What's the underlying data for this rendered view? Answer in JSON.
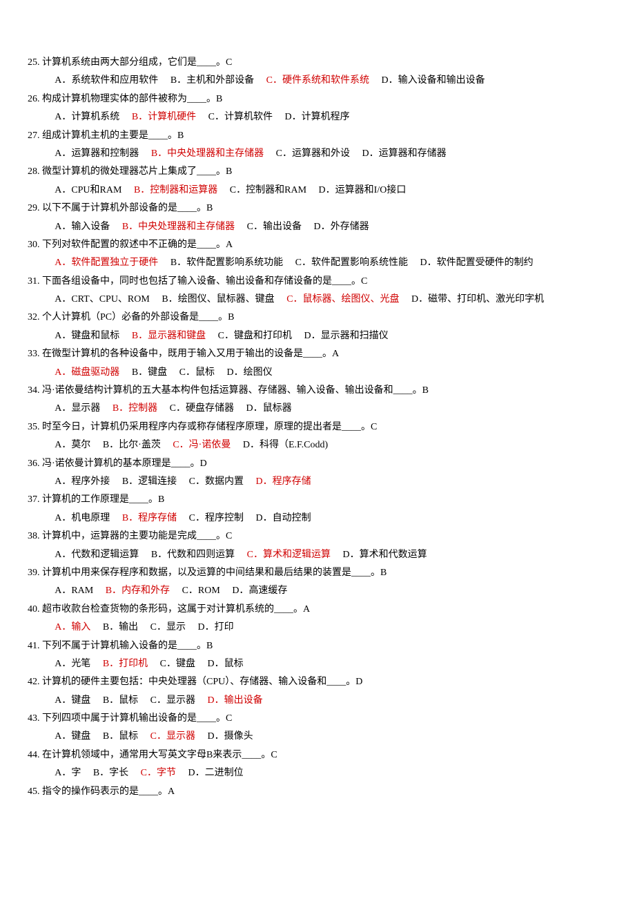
{
  "questions": [
    {
      "num": "25.",
      "text": "计算机系统由两大部分组成，它们是____。",
      "ans": "C",
      "opts": [
        {
          "l": "A．",
          "t": "系统软件和应用软件",
          "c": false
        },
        {
          "l": "B．",
          "t": "主机和外部设备",
          "c": false
        },
        {
          "l": "C．",
          "t": "硬件系统和软件系统",
          "c": true
        },
        {
          "l": "D．",
          "t": "输入设备和输出设备",
          "c": false
        }
      ]
    },
    {
      "num": "26.",
      "text": "构成计算机物理实体的部件被称为____。",
      "ans": "B",
      "opts": [
        {
          "l": "A．",
          "t": "计算机系统",
          "c": false
        },
        {
          "l": "B．",
          "t": "计算机硬件",
          "c": true
        },
        {
          "l": "C．",
          "t": "计算机软件",
          "c": false
        },
        {
          "l": "D．",
          "t": "计算机程序",
          "c": false
        }
      ]
    },
    {
      "num": "27.",
      "text": "组成计算机主机的主要是____。",
      "ans": "B",
      "opts": [
        {
          "l": "A．",
          "t": "运算器和控制器",
          "c": false
        },
        {
          "l": "B．",
          "t": "中央处理器和主存储器",
          "c": true
        },
        {
          "l": "C．",
          "t": "运算器和外设",
          "c": false
        },
        {
          "l": "D．",
          "t": "运算器和存储器",
          "c": false
        }
      ]
    },
    {
      "num": "28.",
      "text": "微型计算机的微处理器芯片上集成了____。",
      "ans": "B",
      "opts": [
        {
          "l": "A．",
          "t": "CPU和RAM",
          "c": false
        },
        {
          "l": "B．",
          "t": "控制器和运算器",
          "c": true
        },
        {
          "l": "C．",
          "t": "控制器和RAM",
          "c": false
        },
        {
          "l": "D．",
          "t": "运算器和I/O接口",
          "c": false
        }
      ]
    },
    {
      "num": "29.",
      "text": "以下不属于计算机外部设备的是____。",
      "ans": "B",
      "opts": [
        {
          "l": "A．",
          "t": "输入设备",
          "c": false
        },
        {
          "l": "B．",
          "t": "中央处理器和主存储器",
          "c": true
        },
        {
          "l": "C．",
          "t": "输出设备",
          "c": false
        },
        {
          "l": "D．",
          "t": "外存储器",
          "c": false
        }
      ]
    },
    {
      "num": "30.",
      "text": "下列对软件配置的叙述中不正确的是____。",
      "ans": "A",
      "opts": [
        {
          "l": "A．",
          "t": "软件配置独立于硬件",
          "c": true
        },
        {
          "l": "B．",
          "t": "软件配置影响系统功能",
          "c": false
        },
        {
          "l": "C．",
          "t": "软件配置影响系统性能",
          "c": false
        },
        {
          "l": "D．",
          "t": "软件配置受硬件的制约",
          "c": false
        }
      ]
    },
    {
      "num": "31.",
      "text": "下面各组设备中，同时也包括了输入设备、输出设备和存储设备的是____。",
      "ans": "C",
      "opts": [
        {
          "l": "A．",
          "t": "CRT、CPU、ROM",
          "c": false
        },
        {
          "l": "B．",
          "t": "绘图仪、鼠标器、键盘",
          "c": false
        },
        {
          "l": "C．",
          "t": "鼠标器、绘图仪、光盘",
          "c": true
        },
        {
          "l": "D．",
          "t": "磁带、打印机、激光印字机",
          "c": false
        }
      ]
    },
    {
      "num": "32.",
      "text": "个人计算机（PC）必备的外部设备是____。",
      "ans": "B",
      "opts": [
        {
          "l": "A．",
          "t": "键盘和鼠标",
          "c": false
        },
        {
          "l": "B．",
          "t": "显示器和键盘",
          "c": true
        },
        {
          "l": "C．",
          "t": "键盘和打印机",
          "c": false
        },
        {
          "l": "D．",
          "t": "显示器和扫描仪",
          "c": false
        }
      ]
    },
    {
      "num": "33.",
      "text": "在微型计算机的各种设备中，既用于输入又用于输出的设备是____。",
      "ans": "A",
      "opts": [
        {
          "l": "A．",
          "t": "磁盘驱动器",
          "c": true
        },
        {
          "l": "B．",
          "t": "键盘",
          "c": false
        },
        {
          "l": "C．",
          "t": "鼠标",
          "c": false
        },
        {
          "l": "D．",
          "t": "绘图仪",
          "c": false
        }
      ]
    },
    {
      "num": "34.",
      "text": "冯·诺依曼结构计算机的五大基本构件包括运算器、存储器、输入设备、输出设备和____。",
      "ans": "B",
      "opts": [
        {
          "l": "A．",
          "t": "显示器",
          "c": false
        },
        {
          "l": "B．",
          "t": "控制器",
          "c": true
        },
        {
          "l": "C．",
          "t": "硬盘存储器",
          "c": false
        },
        {
          "l": "D．",
          "t": "鼠标器",
          "c": false
        }
      ]
    },
    {
      "num": "35.",
      "text": "时至今日，计算机仍采用程序内存或称存储程序原理，原理的提出者是____。",
      "ans": "C",
      "opts": [
        {
          "l": "A．",
          "t": "莫尔",
          "c": false
        },
        {
          "l": "B．",
          "t": "比尔·盖茨",
          "c": false
        },
        {
          "l": "C．",
          "t": "冯·诺依曼",
          "c": true
        },
        {
          "l": "D．",
          "t": "科得（E.F.Codd)",
          "c": false
        }
      ]
    },
    {
      "num": "36.",
      "text": "冯·诺依曼计算机的基本原理是____。",
      "ans": "D",
      "opts": [
        {
          "l": "A．",
          "t": "程序外接",
          "c": false
        },
        {
          "l": "B．",
          "t": "逻辑连接",
          "c": false
        },
        {
          "l": "C．",
          "t": "数据内置",
          "c": false
        },
        {
          "l": "D．",
          "t": "程序存储",
          "c": true
        }
      ]
    },
    {
      "num": "37.",
      "text": "计算机的工作原理是____。",
      "ans": "B",
      "opts": [
        {
          "l": "A．",
          "t": "机电原理",
          "c": false
        },
        {
          "l": "B．",
          "t": "程序存储",
          "c": true
        },
        {
          "l": "C．",
          "t": "程序控制",
          "c": false
        },
        {
          "l": "D．",
          "t": "自动控制",
          "c": false
        }
      ]
    },
    {
      "num": "38.",
      "text": "计算机中，运算器的主要功能是完成____。",
      "ans": "C",
      "opts": [
        {
          "l": "A．",
          "t": "代数和逻辑运算",
          "c": false
        },
        {
          "l": "B．",
          "t": "代数和四则运算",
          "c": false
        },
        {
          "l": "C．",
          "t": "算术和逻辑运算",
          "c": true
        },
        {
          "l": "D．",
          "t": "算术和代数运算",
          "c": false
        }
      ]
    },
    {
      "num": "39.",
      "text": "计算机中用来保存程序和数据，以及运算的中间结果和最后结果的装置是____。",
      "ans": "B",
      "opts": [
        {
          "l": "A．",
          "t": "RAM",
          "c": false
        },
        {
          "l": "B．",
          "t": "内存和外存",
          "c": true
        },
        {
          "l": "C．",
          "t": "ROM",
          "c": false
        },
        {
          "l": "D．",
          "t": "高速缓存",
          "c": false
        }
      ]
    },
    {
      "num": "40.",
      "text": "超市收款台检查货物的条形码，这属于对计算机系统的____。",
      "ans": "A",
      "opts": [
        {
          "l": "A．",
          "t": "输入",
          "c": true
        },
        {
          "l": "B．",
          "t": "输出",
          "c": false
        },
        {
          "l": "C．",
          "t": "显示",
          "c": false
        },
        {
          "l": "D．",
          "t": "打印",
          "c": false
        }
      ]
    },
    {
      "num": "41.",
      "text": "下列不属于计算机输入设备的是____。",
      "ans": "B",
      "opts": [
        {
          "l": "A．",
          "t": "光笔",
          "c": false
        },
        {
          "l": "B．",
          "t": "打印机",
          "c": true
        },
        {
          "l": "C．",
          "t": "键盘",
          "c": false
        },
        {
          "l": "D．",
          "t": "鼠标",
          "c": false
        }
      ]
    },
    {
      "num": "42.",
      "text": "计算机的硬件主要包括：中央处理器（CPU）、存储器、输入设备和____。",
      "ans": "D",
      "opts": [
        {
          "l": "A．",
          "t": "键盘",
          "c": false
        },
        {
          "l": "B．",
          "t": "鼠标",
          "c": false
        },
        {
          "l": "C．",
          "t": "显示器",
          "c": false
        },
        {
          "l": "D．",
          "t": "输出设备",
          "c": true
        }
      ]
    },
    {
      "num": "43.",
      "text": "下列四项中属于计算机输出设备的是____。",
      "ans": "C",
      "opts": [
        {
          "l": "A．",
          "t": "键盘",
          "c": false
        },
        {
          "l": "B．",
          "t": "鼠标",
          "c": false
        },
        {
          "l": "C．",
          "t": "显示器",
          "c": true
        },
        {
          "l": "D．",
          "t": "摄像头",
          "c": false
        }
      ]
    },
    {
      "num": "44.",
      "text": "在计算机领域中，通常用大写英文字母B来表示____。",
      "ans": "C",
      "opts": [
        {
          "l": "A．",
          "t": "字",
          "c": false
        },
        {
          "l": "B．",
          "t": "字长",
          "c": false
        },
        {
          "l": "C．",
          "t": "字节",
          "c": true
        },
        {
          "l": "D．",
          "t": "二进制位",
          "c": false
        }
      ]
    },
    {
      "num": "45.",
      "text": "指令的操作码表示的是____。",
      "ans": "A",
      "opts": []
    }
  ]
}
